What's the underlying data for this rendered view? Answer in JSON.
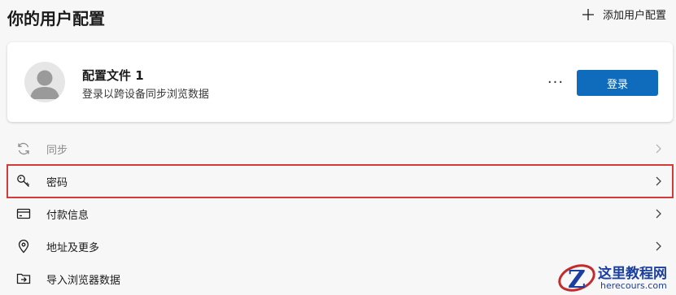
{
  "header": {
    "title": "你的用户配置",
    "add_profile_label": "添加用户配置"
  },
  "profile": {
    "name": "配置文件 1",
    "description": "登录以跨设备同步浏览数据",
    "more_label": "···",
    "signin_label": "登录"
  },
  "menu": {
    "items": [
      {
        "label": "同步",
        "icon": "sync-icon",
        "state": "disabled"
      },
      {
        "label": "密码",
        "icon": "key-icon",
        "state": "highlighted"
      },
      {
        "label": "付款信息",
        "icon": "credit-card-icon",
        "state": "normal"
      },
      {
        "label": "地址及更多",
        "icon": "location-pin-icon",
        "state": "normal"
      },
      {
        "label": "导入浏览器数据",
        "icon": "import-folder-icon",
        "state": "normal"
      }
    ]
  },
  "watermark": {
    "title": "这里教程网",
    "url": "herecours.com"
  },
  "colors": {
    "accent": "#0f6cbd",
    "highlight_border": "#d33a3a",
    "background": "#f7f7f7",
    "watermark": "#1b3fa0"
  }
}
